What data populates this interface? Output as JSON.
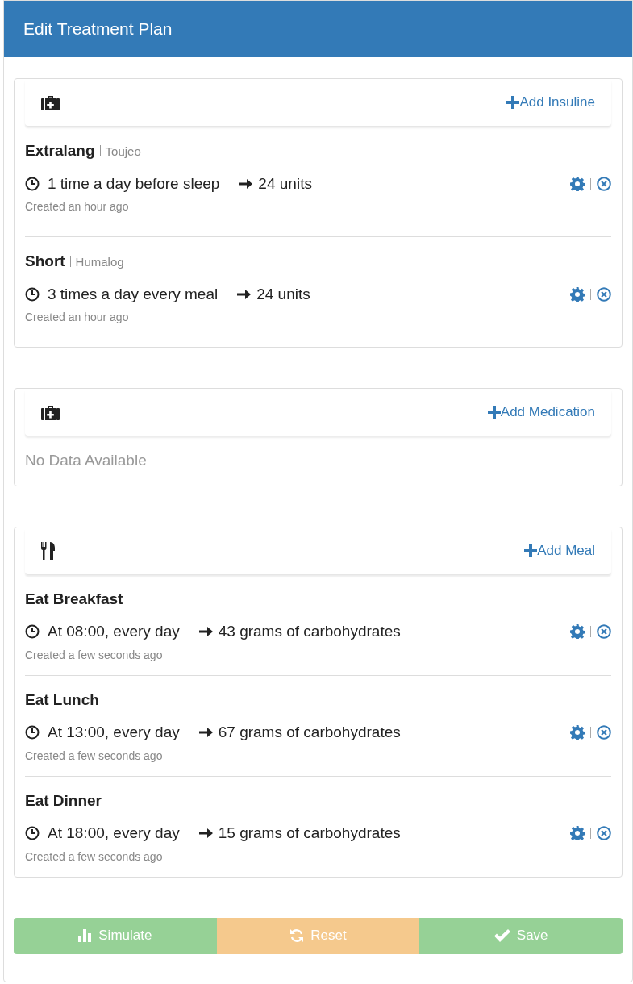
{
  "window": {
    "title": "Edit Treatment Plan"
  },
  "sections": [
    {
      "kind": "insulin",
      "add_label": "Add Insuline",
      "items": [
        {
          "title": "Extralang",
          "subtitle": "Toujeo",
          "schedule": "1 time a day before sleep",
          "amount": "24 units",
          "created": "Created an hour ago"
        },
        {
          "title": "Short",
          "subtitle": "Humalog",
          "schedule": "3 times a day every meal",
          "amount": "24 units",
          "created": "Created an hour ago"
        }
      ]
    },
    {
      "kind": "medication",
      "add_label": "Add Medication",
      "empty_text": "No Data Available"
    },
    {
      "kind": "meal",
      "add_label": "Add Meal",
      "items": [
        {
          "title": "Eat Breakfast",
          "schedule": "At 08:00, every day",
          "amount": "43 grams of carbohydrates",
          "created": "Created a few seconds ago"
        },
        {
          "title": "Eat Lunch",
          "schedule": "At 13:00, every day",
          "amount": "67 grams of carbohydrates",
          "created": "Created a few seconds ago"
        },
        {
          "title": "Eat Dinner",
          "schedule": "At 18:00, every day",
          "amount": "15 grams of carbohydrates",
          "created": "Created a few seconds ago"
        }
      ]
    }
  ],
  "buttons": [
    {
      "kind": "simulate",
      "label": "Simulate"
    },
    {
      "kind": "reset",
      "label": "Reset"
    },
    {
      "kind": "save",
      "label": "Save"
    }
  ]
}
